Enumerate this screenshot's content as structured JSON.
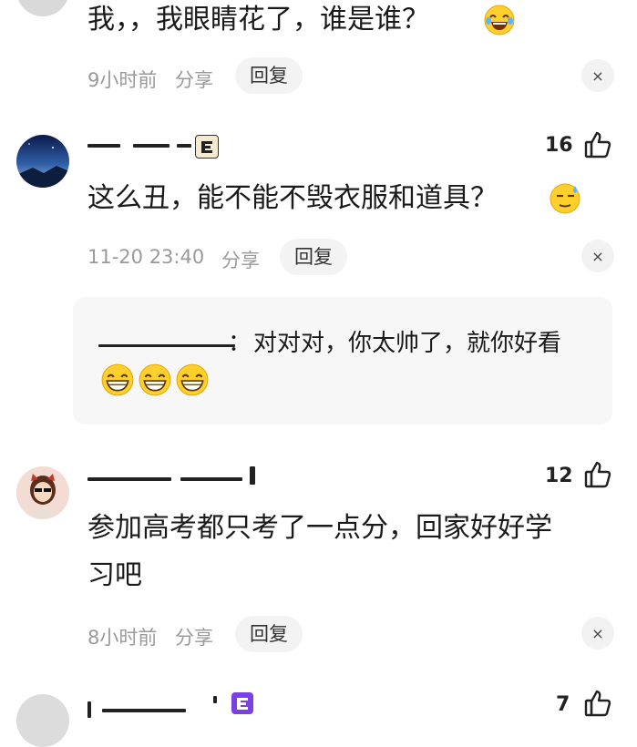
{
  "comments": [
    {
      "text": "我，，我眼睛花了，谁是谁？",
      "time": "9小时前",
      "share": "分享",
      "reply": "回复",
      "close": "×",
      "emoji": "laughing-tears-emoji"
    },
    {
      "text": "这么丑，能不能不毁衣服和道具？",
      "time": "11-20 23:40",
      "share": "分享",
      "reply": "回复",
      "close": "×",
      "likes": "16",
      "emoji": "sweat-emoji",
      "sub_reply": {
        "separator": "：",
        "text": "对对对，你太帅了，就你好看",
        "emojis": [
          "grin-emoji",
          "grin-emoji",
          "grin-emoji"
        ]
      }
    },
    {
      "text_line1": "参加高考都只考了一点分，回家好好学",
      "text_line2": "习吧",
      "time": "8小时前",
      "share": "分享",
      "reply": "回复",
      "close": "×",
      "likes": "12"
    },
    {
      "likes": "7"
    }
  ],
  "colors": {
    "meta_gray": "#9a9a9a",
    "reply_bg": "#f3f3f3",
    "box_bg": "#f7f7f8",
    "badge_purple": "#7b3fe4"
  }
}
